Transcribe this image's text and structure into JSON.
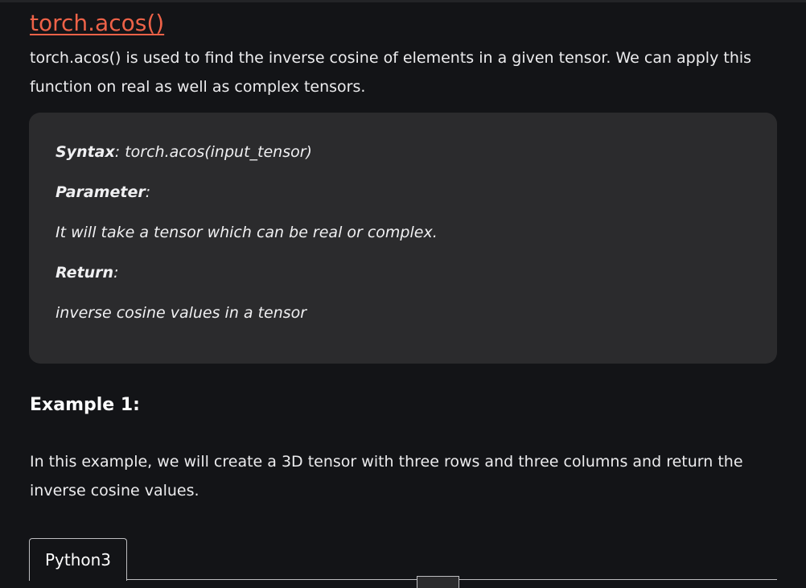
{
  "heading": {
    "link_text": "torch.acos()"
  },
  "intro": {
    "text": "torch.acos() is used to find the inverse cosine of elements in a given tensor. We can apply this function on real as well as complex tensors."
  },
  "syntax_box": {
    "syntax_label": "Syntax",
    "syntax_value": ": torch.acos(input_tensor)",
    "parameter_label": "Parameter",
    "parameter_suffix": ":",
    "parameter_desc": "It will take a tensor which can be real or complex.",
    "return_label": "Return",
    "return_suffix": ":",
    "return_desc": "inverse cosine values in  a tensor"
  },
  "example": {
    "title": "Example 1:",
    "description": "In this example, we will create a 3D  tensor with three rows and three columns and return the inverse cosine values."
  },
  "code_tabs": {
    "active_label": "Python3"
  }
}
